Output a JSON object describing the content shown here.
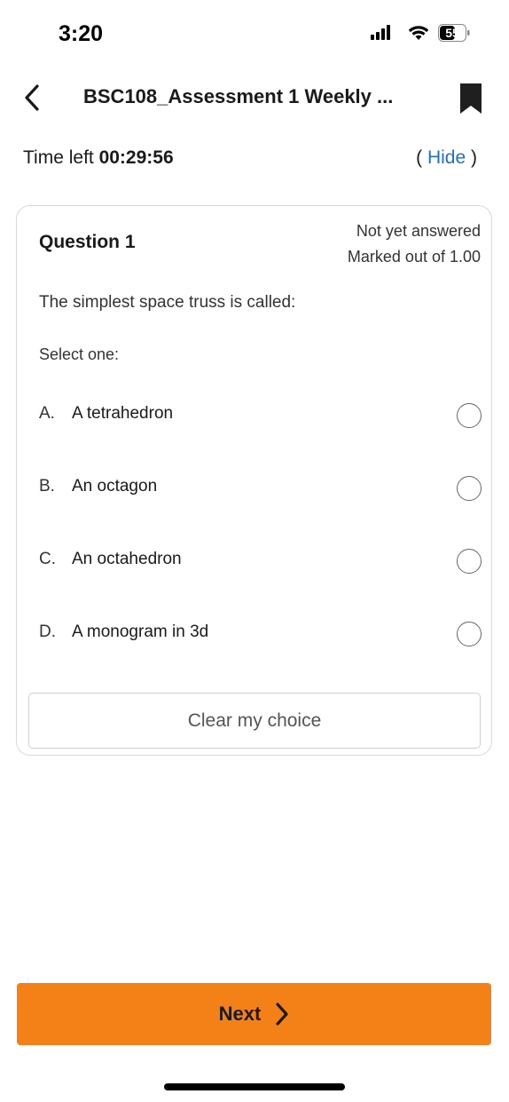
{
  "status_bar": {
    "time": "3:20",
    "battery_level": "55",
    "icons": [
      "signal-icon",
      "wifi-icon",
      "battery-icon"
    ]
  },
  "header": {
    "title": "BSC108_Assessment 1 Weekly ...",
    "back_icon": "chevron-left-icon",
    "bookmark_icon": "bookmark-icon"
  },
  "timer": {
    "label": "Time left",
    "value": "00:29:56",
    "hide_open": "(",
    "hide_label": "Hide",
    "hide_close": ")"
  },
  "question": {
    "number_label": "Question 1",
    "status_line1": "Not yet answered",
    "status_line2": "Marked out of 1.00",
    "text": "The simplest space truss is called:",
    "instruction": "Select one:",
    "options": [
      {
        "letter": "A.",
        "text": "A tetrahedron",
        "selected": false
      },
      {
        "letter": "B.",
        "text": "An octagon",
        "selected": false
      },
      {
        "letter": "C.",
        "text": "An octahedron",
        "selected": false
      },
      {
        "letter": "D.",
        "text": "A monogram in 3d",
        "selected": false
      }
    ],
    "clear_label": "Clear my choice"
  },
  "footer": {
    "next_label": "Next",
    "next_icon": "chevron-right-icon"
  },
  "colors": {
    "accent": "#f48117",
    "link": "#1a73c9",
    "text": "#1a1a1a"
  }
}
